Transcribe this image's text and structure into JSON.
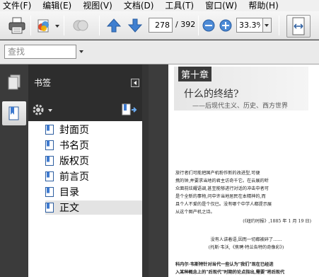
{
  "menu": {
    "items": [
      "文件(F)",
      "编辑(E)",
      "视图(V)",
      "文档(D)",
      "工具(T)",
      "窗口(W)",
      "帮助(H)"
    ]
  },
  "toolbar": {
    "page_current": "278",
    "page_total": "/ 392",
    "zoom": "33.3%",
    "icons": [
      "print-icon",
      "create-icon",
      "web-icon",
      "prev-page-icon",
      "next-page-icon",
      "zoom-out-icon",
      "zoom-in-icon",
      "fit-width-icon"
    ]
  },
  "search": {
    "placeholder": "查找"
  },
  "panel": {
    "title": "书签",
    "bookmarks": [
      {
        "label": "封面页",
        "selected": false
      },
      {
        "label": "书名页",
        "selected": false
      },
      {
        "label": "版权页",
        "selected": false
      },
      {
        "label": "前言页",
        "selected": false
      },
      {
        "label": "目录",
        "selected": false
      },
      {
        "label": "正文",
        "selected": true
      }
    ]
  },
  "document": {
    "chapter_tag": "第十章",
    "chapter_title": "什么的终结?",
    "chapter_subtitle": "——后现代主义、历史、西方世界",
    "lines": [
      "旅行者们可能把国产机粉作新的改进型,可便",
      "携的钟,并要求当地的君主访奇千它。在云展的听",
      "众面前炫耀语调,甚至能够进行对话的冲击中者可",
      "是个全新的事物,问中许当地居民在本精神的,而",
      "且个人不爱的是个仅已。没有哪个中学人都提示展",
      "从这个图产机之诗。"
    ],
    "citation": "(《纽约时报》,1885 年 1 月 19 日)",
    "quote1": "没有人讲着语,因而一切都被碎了……",
    "quote2": "(托斯·韦沃,《焦聘·特兰告特的奇像彩》)",
    "para2_line1": "科内尔·韦斯特针对当代一些认为\"我们\"现在已经进",
    "para2_line2": "入某种概念上的\"后现代\"时期的论点指出,需要\"将后现代"
  }
}
